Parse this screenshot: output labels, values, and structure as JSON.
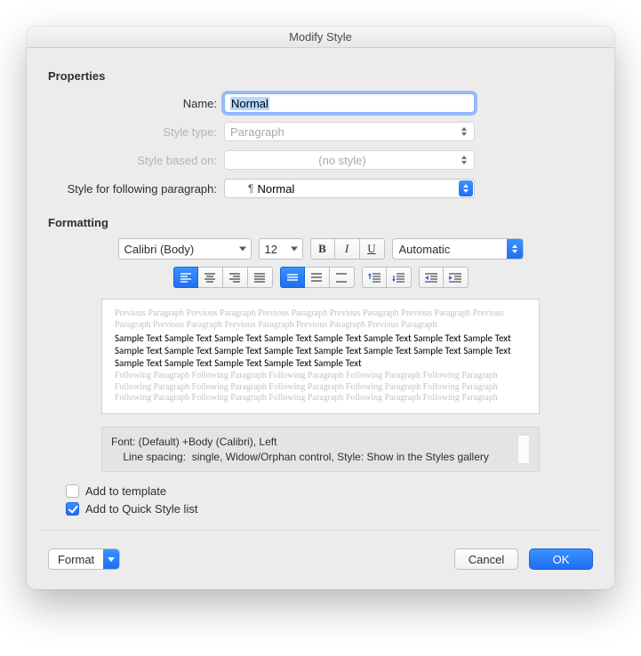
{
  "window": {
    "title": "Modify Style"
  },
  "sections": {
    "properties": "Properties",
    "formatting": "Formatting"
  },
  "labels": {
    "name": "Name:",
    "style_type": "Style type:",
    "based_on": "Style based on:",
    "following": "Style for following paragraph:"
  },
  "fields": {
    "name_value": "Normal",
    "style_type_value": "Paragraph",
    "based_on_value": "(no style)",
    "following_value": "Normal"
  },
  "font_row": {
    "font": "Calibri (Body)",
    "size": "12",
    "color": "Automatic"
  },
  "preview": {
    "prev": "Previous Paragraph Previous Paragraph Previous Paragraph Previous Paragraph Previous Paragraph Previous Paragraph Previous Paragraph Previous Paragraph Previous Paragraph Previous Paragraph",
    "sample": "Sample Text Sample Text Sample Text Sample Text Sample Text Sample Text Sample Text Sample Text Sample Text Sample Text Sample Text Sample Text Sample Text Sample Text Sample Text Sample Text Sample Text Sample Text Sample Text Sample Text Sample Text",
    "next": "Following Paragraph Following Paragraph Following Paragraph Following Paragraph Following Paragraph Following Paragraph Following Paragraph Following Paragraph Following Paragraph Following Paragraph Following Paragraph Following Paragraph Following Paragraph Following Paragraph Following Paragraph"
  },
  "description": {
    "line1": "Font: (Default) +Body (Calibri), Left",
    "line2": "    Line spacing:  single, Widow/Orphan control, Style: Show in the Styles gallery"
  },
  "checks": {
    "add_template": "Add to template",
    "add_quick": "Add to Quick Style list"
  },
  "footer": {
    "format": "Format",
    "cancel": "Cancel",
    "ok": "OK"
  }
}
